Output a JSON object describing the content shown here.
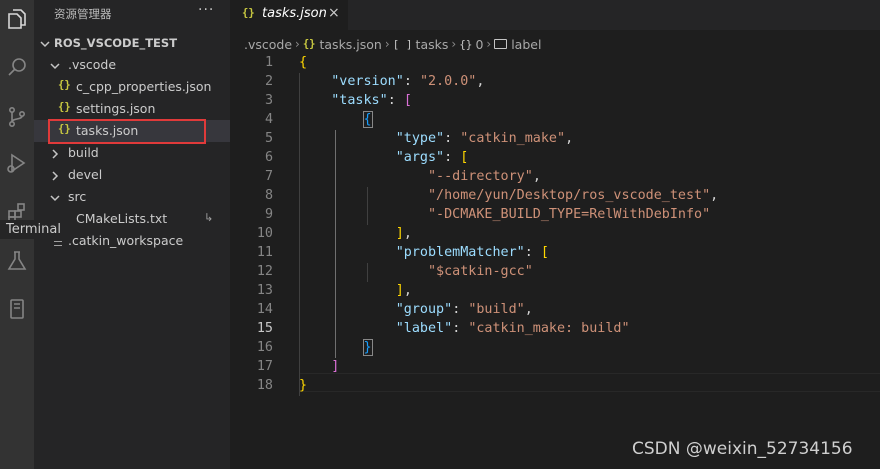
{
  "sidebar": {
    "header": "资源管理器",
    "more": "···",
    "tree": [
      {
        "label": "ROS_VSCODE_TEST",
        "kind": "folder-open",
        "bold": true
      },
      {
        "label": ".vscode",
        "kind": "folder-open"
      },
      {
        "label": "c_cpp_properties.json",
        "kind": "json"
      },
      {
        "label": "settings.json",
        "kind": "json"
      },
      {
        "label": "tasks.json",
        "kind": "json",
        "selected": true
      },
      {
        "label": "build",
        "kind": "folder-closed"
      },
      {
        "label": "devel",
        "kind": "folder-closed"
      },
      {
        "label": "src",
        "kind": "folder-open"
      },
      {
        "label": "CMakeLists.txt",
        "kind": "file"
      },
      {
        "label": ".catkin_workspace",
        "kind": "lines"
      }
    ],
    "tooltip": "Terminal"
  },
  "activity_icons": [
    "explorer-icon",
    "search-icon",
    "source-control-icon",
    "run-debug-icon",
    "extensions-icon",
    "testing-flask-icon",
    "remote-device-icon"
  ],
  "tab": {
    "icon": "{}",
    "label": "tasks.json",
    "close": "×"
  },
  "breadcrumb": {
    "items": [
      ".vscode",
      "tasks.json",
      "tasks",
      "0",
      "label"
    ],
    "icons": [
      "",
      "{}",
      "[ ]",
      "{}",
      ""
    ],
    "separator": "›"
  },
  "editor": {
    "current_line": 15,
    "lines": [
      {
        "n": "1",
        "tokens": [
          {
            "t": "{",
            "c": "b1"
          }
        ]
      },
      {
        "n": "2",
        "tokens": [
          {
            "t": "    "
          },
          {
            "t": "\"version\"",
            "c": "key"
          },
          {
            "t": ": ",
            "c": "punc"
          },
          {
            "t": "\"2.0.0\"",
            "c": "str"
          },
          {
            "t": ",",
            "c": "punc"
          }
        ]
      },
      {
        "n": "3",
        "tokens": [
          {
            "t": "    "
          },
          {
            "t": "\"tasks\"",
            "c": "key"
          },
          {
            "t": ": ",
            "c": "punc"
          },
          {
            "t": "[",
            "c": "b2"
          }
        ]
      },
      {
        "n": "4",
        "tokens": [
          {
            "t": "        "
          },
          {
            "t": "{",
            "c": "b3 bracket-match"
          }
        ]
      },
      {
        "n": "5",
        "tokens": [
          {
            "t": "            "
          },
          {
            "t": "\"type\"",
            "c": "key"
          },
          {
            "t": ": ",
            "c": "punc"
          },
          {
            "t": "\"catkin_make\"",
            "c": "str"
          },
          {
            "t": ",",
            "c": "punc"
          }
        ]
      },
      {
        "n": "6",
        "tokens": [
          {
            "t": "            "
          },
          {
            "t": "\"args\"",
            "c": "key"
          },
          {
            "t": ": ",
            "c": "punc"
          },
          {
            "t": "[",
            "c": "b1"
          }
        ]
      },
      {
        "n": "7",
        "tokens": [
          {
            "t": "                "
          },
          {
            "t": "\"--directory\"",
            "c": "str"
          },
          {
            "t": ",",
            "c": "punc"
          }
        ]
      },
      {
        "n": "8",
        "tokens": [
          {
            "t": "                "
          },
          {
            "t": "\"/home/yun/Desktop/ros_vscode_test\"",
            "c": "str"
          },
          {
            "t": ",",
            "c": "punc"
          }
        ]
      },
      {
        "n": "9",
        "tokens": [
          {
            "t": "                "
          },
          {
            "t": "\"-DCMAKE_BUILD_TYPE=RelWithDebInfo\"",
            "c": "str"
          }
        ]
      },
      {
        "n": "10",
        "tokens": [
          {
            "t": "            "
          },
          {
            "t": "]",
            "c": "b1"
          },
          {
            "t": ",",
            "c": "punc"
          }
        ]
      },
      {
        "n": "11",
        "tokens": [
          {
            "t": "            "
          },
          {
            "t": "\"problemMatcher\"",
            "c": "key"
          },
          {
            "t": ": ",
            "c": "punc"
          },
          {
            "t": "[",
            "c": "b1"
          }
        ]
      },
      {
        "n": "12",
        "tokens": [
          {
            "t": "                "
          },
          {
            "t": "\"$catkin-gcc\"",
            "c": "str"
          }
        ]
      },
      {
        "n": "13",
        "tokens": [
          {
            "t": "            "
          },
          {
            "t": "]",
            "c": "b1"
          },
          {
            "t": ",",
            "c": "punc"
          }
        ]
      },
      {
        "n": "14",
        "tokens": [
          {
            "t": "            "
          },
          {
            "t": "\"group\"",
            "c": "key"
          },
          {
            "t": ": ",
            "c": "punc"
          },
          {
            "t": "\"build\"",
            "c": "str"
          },
          {
            "t": ",",
            "c": "punc"
          }
        ]
      },
      {
        "n": "15",
        "tokens": [
          {
            "t": "            "
          },
          {
            "t": "\"label\"",
            "c": "key"
          },
          {
            "t": ": ",
            "c": "punc"
          },
          {
            "t": "\"catkin_make: build\"",
            "c": "str"
          }
        ]
      },
      {
        "n": "16",
        "tokens": [
          {
            "t": "        "
          },
          {
            "t": "}",
            "c": "b3 bracket-match"
          }
        ]
      },
      {
        "n": "17",
        "tokens": [
          {
            "t": "    "
          },
          {
            "t": "]",
            "c": "b2"
          }
        ]
      },
      {
        "n": "18",
        "tokens": [
          {
            "t": "}",
            "c": "b1"
          }
        ]
      }
    ]
  },
  "watermark": "CSDN @weixin_52734156",
  "colors": {
    "accent_highlight": "#e03a3a",
    "json_icon": "#cbcb41",
    "key": "#9cdcfe",
    "string": "#ce9178"
  }
}
